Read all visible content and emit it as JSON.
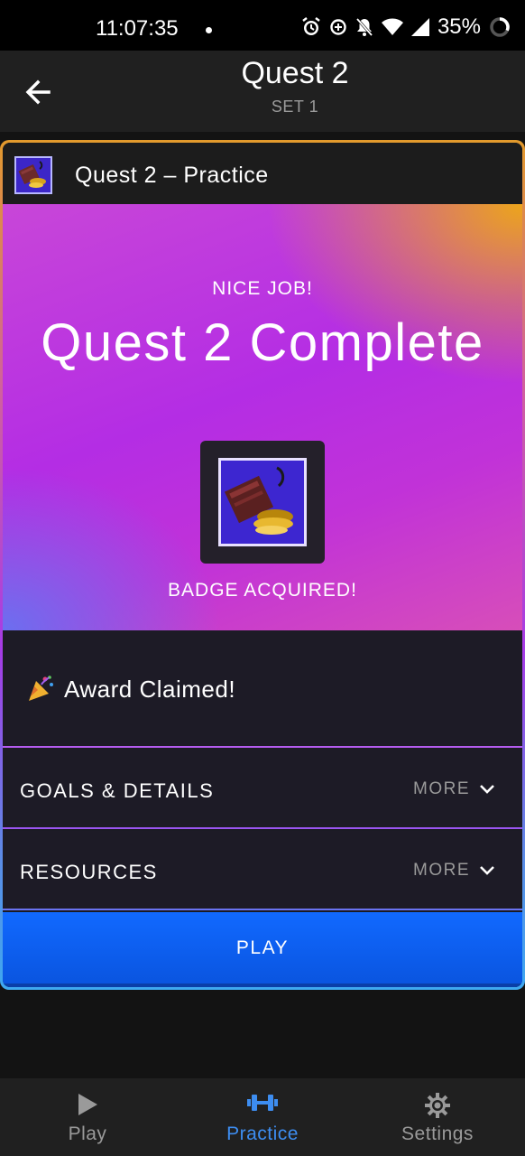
{
  "status_bar": {
    "time": "11:07:35",
    "battery_percent": "35%",
    "icons": [
      "alarm-icon",
      "data-saver-icon",
      "notifications-off-icon",
      "wifi-icon",
      "signal-icon",
      "battery-ring-icon"
    ]
  },
  "app_bar": {
    "title": "Quest 2",
    "subtitle": "SET 1",
    "back_icon": "arrow-left-icon"
  },
  "card": {
    "header_title": "Quest 2 – Practice",
    "hero": {
      "nice_job": "NICE JOB!",
      "complete_title": "Quest 2 Complete",
      "badge_caption": "BADGE ACQUIRED!"
    },
    "award": {
      "icon": "party-popper-icon",
      "text": "Award Claimed!"
    },
    "sections": [
      {
        "label": "GOALS & DETAILS",
        "more": "MORE"
      },
      {
        "label": "RESOURCES",
        "more": "MORE"
      }
    ],
    "play_label": "PLAY"
  },
  "bottom_nav": {
    "items": [
      {
        "label": "Play",
        "icon": "play-triangle-icon",
        "active": false
      },
      {
        "label": "Practice",
        "icon": "dumbbell-icon",
        "active": true
      },
      {
        "label": "Settings",
        "icon": "gear-icon",
        "active": false
      }
    ]
  },
  "colors": {
    "accent_blue": "#1169ff",
    "active_nav": "#3d8df0",
    "hero_orange": "#eca51b",
    "hero_magenta": "#b42de4"
  }
}
